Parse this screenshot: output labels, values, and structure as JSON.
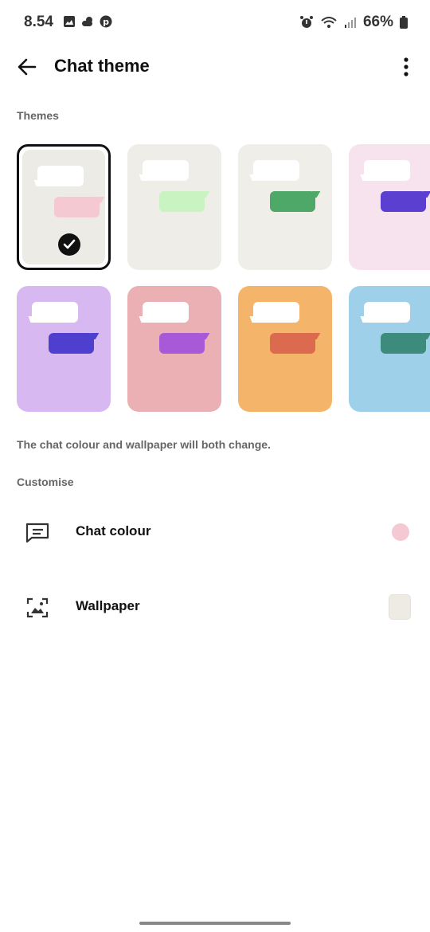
{
  "status": {
    "time": "8.54",
    "battery": "66%"
  },
  "appbar": {
    "title": "Chat theme"
  },
  "themes": {
    "label": "Themes",
    "items": [
      {
        "name": "default-beige",
        "selected": true,
        "bg": "#ecebe6",
        "outgoing": "#f5c9d2"
      },
      {
        "name": "beige-green-light",
        "selected": false,
        "bg": "#eeede8",
        "outgoing": "#c9f3c1"
      },
      {
        "name": "beige-green",
        "selected": false,
        "bg": "#efeee9",
        "outgoing": "#4ea868"
      },
      {
        "name": "pink-purple",
        "selected": false,
        "bg": "#f6e3ee",
        "outgoing": "#5a3fd1"
      },
      {
        "name": "lavender",
        "selected": false,
        "bg": "#d8b8f0",
        "outgoing": "#4f3fcf"
      },
      {
        "name": "pink-floral",
        "selected": false,
        "bg": "#eab0b3",
        "outgoing": "#a859d8"
      },
      {
        "name": "orange",
        "selected": false,
        "bg": "#f4b56a",
        "outgoing": "#db6a4e"
      },
      {
        "name": "beach",
        "selected": false,
        "bg": "#9fd0ea",
        "outgoing": "#3c8b7c"
      }
    ]
  },
  "helper_text": "The chat colour and wallpaper will both change.",
  "customise": {
    "label": "Customise",
    "chat_colour": {
      "label": "Chat colour",
      "icon": "chat-bubble-icon",
      "swatch": "#f4c9d3"
    },
    "wallpaper": {
      "label": "Wallpaper",
      "icon": "wallpaper-icon",
      "swatch": "#eeebe5"
    }
  }
}
